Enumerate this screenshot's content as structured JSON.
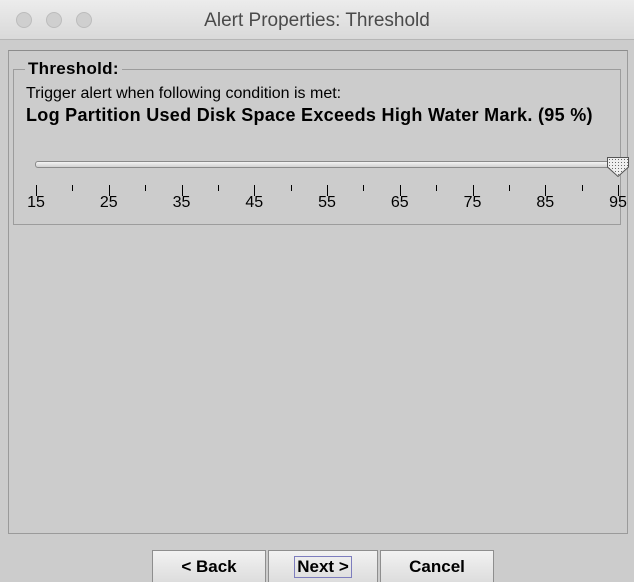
{
  "window": {
    "title": "Alert Properties: Threshold"
  },
  "threshold": {
    "legend": "Threshold:",
    "description": "Trigger alert when following condition is met:",
    "condition": "Log Partition Used Disk Space Exceeds High Water Mark. (95 %)"
  },
  "slider": {
    "min": 15,
    "max": 95,
    "value": 95,
    "major_labels": [
      "15",
      "25",
      "35",
      "45",
      "55",
      "65",
      "75",
      "85",
      "95"
    ]
  },
  "buttons": {
    "back": "< Back",
    "next": "Next >",
    "cancel": "Cancel"
  }
}
